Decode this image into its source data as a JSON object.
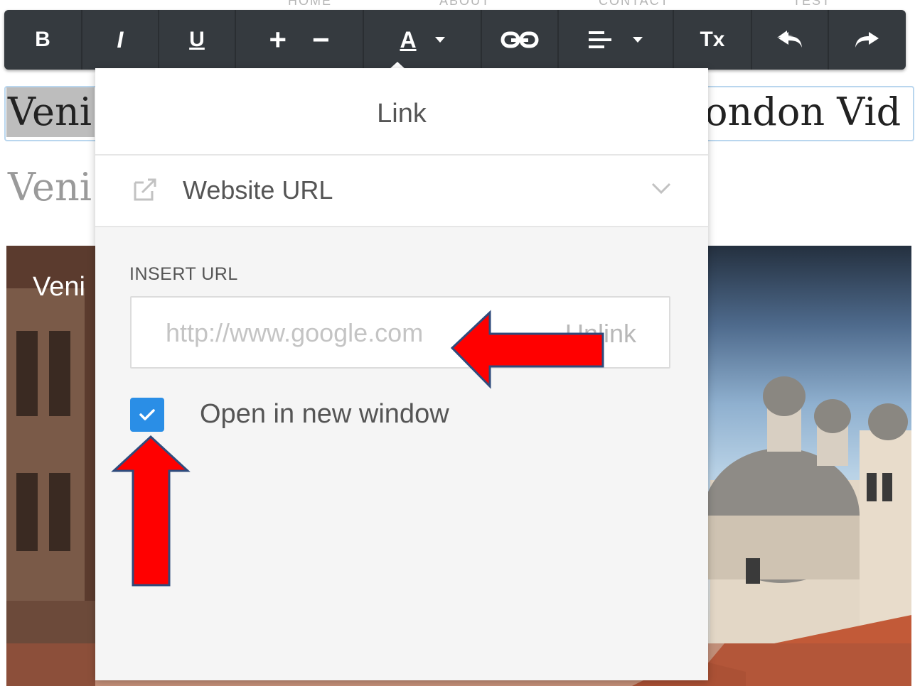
{
  "nav_ghost": [
    "HOME",
    "ABOUT",
    "CONTACT",
    "TEST"
  ],
  "toolbar": {
    "bold": "B",
    "italic": "I",
    "underline": "U",
    "font_increase": "+",
    "font_decrease": "−",
    "text_color": "A",
    "clear_format": "Tx",
    "icons": [
      "bold-icon",
      "italic-icon",
      "underline-icon",
      "plus-icon",
      "minus-icon",
      "text-color-icon",
      "link-icon",
      "align-icon",
      "clear-format-icon",
      "undo-icon",
      "redo-icon"
    ]
  },
  "page": {
    "heading_left": "Veni",
    "heading_right": "ondon Vid",
    "subheading_left": "Veni",
    "photo_caption": "Veni"
  },
  "link_popover": {
    "title": "Link",
    "link_type": "Website URL",
    "insert_label": "INSERT URL",
    "url_placeholder": "http://www.google.com",
    "url_value": "",
    "unlink_label": "Unlink",
    "open_new_window_label": "Open in new window",
    "open_new_window_checked": true
  },
  "colors": {
    "toolbar_bg": "#353a3f",
    "checkbox_accent": "#2a8ee6",
    "annotation_arrow": "#ff0000",
    "annotation_outline": "#2f4b7c"
  }
}
